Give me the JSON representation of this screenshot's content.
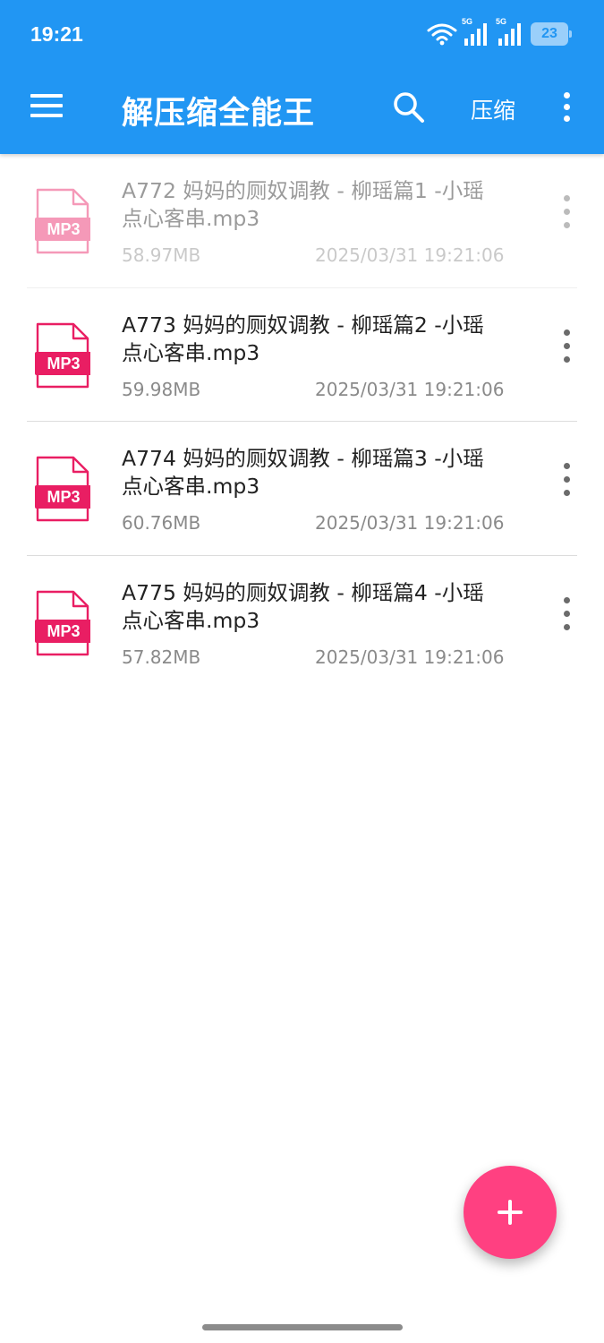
{
  "status_bar": {
    "time": "19:21",
    "signal1_label": "5G",
    "signal2_label": "5G",
    "battery": "23"
  },
  "app_bar": {
    "title": "解压缩全能王",
    "compress_label": "压缩",
    "menu_icon": "hamburger-menu-icon",
    "search_icon": "search-icon",
    "overflow_icon": "more-vertical-icon"
  },
  "files": [
    {
      "name": "A772 妈妈的厕奴调教 - 柳瑶篇1 -小瑶 点心客串.mp3",
      "size": "58.97MB",
      "date": "2025/03/31 19:21:06",
      "icon_label": "MP3",
      "dimmed": true
    },
    {
      "name": "A773 妈妈的厕奴调教 - 柳瑶篇2 -小瑶 点心客串.mp3",
      "size": "59.98MB",
      "date": "2025/03/31 19:21:06",
      "icon_label": "MP3",
      "dimmed": false
    },
    {
      "name": "A774 妈妈的厕奴调教 - 柳瑶篇3 -小瑶 点心客串.mp3",
      "size": "60.76MB",
      "date": "2025/03/31 19:21:06",
      "icon_label": "MP3",
      "dimmed": false
    },
    {
      "name": "A775 妈妈的厕奴调教 - 柳瑶篇4 -小瑶 点心客串.mp3",
      "size": "57.82MB",
      "date": "2025/03/31 19:21:06",
      "icon_label": "MP3",
      "dimmed": false
    }
  ],
  "fab": {
    "icon": "plus-icon"
  },
  "colors": {
    "app_bar": "#2196F3",
    "accent": "#FF4081",
    "file_icon": "#E91E63"
  }
}
